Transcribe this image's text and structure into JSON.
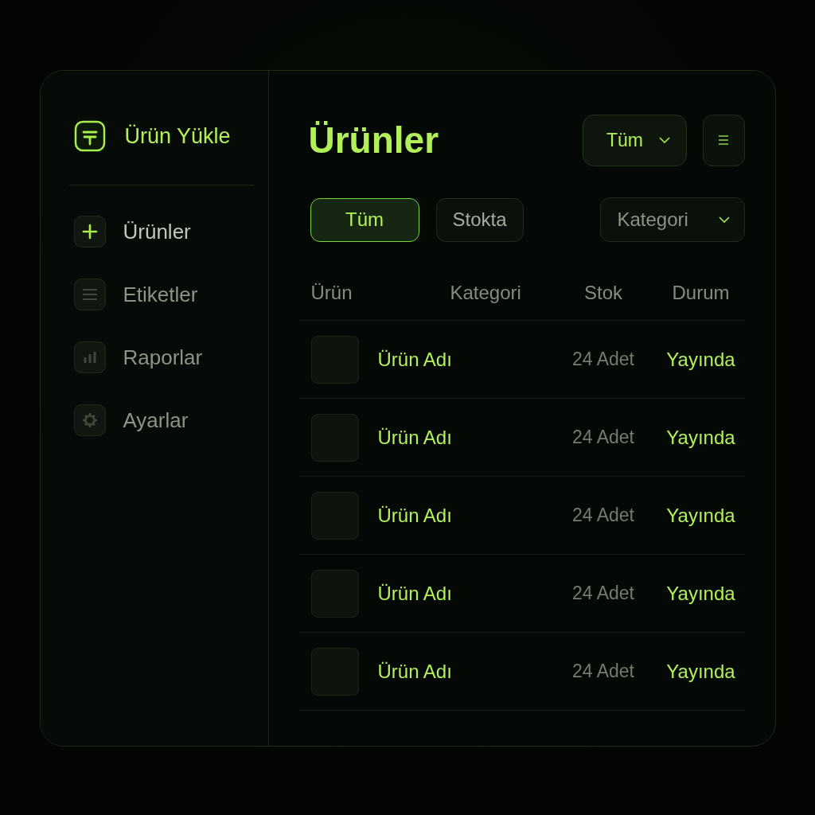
{
  "sidebar": {
    "brand": "Ürün Yükle",
    "items": [
      {
        "label": "Ürünler",
        "kind": "plus",
        "selected": true
      },
      {
        "label": "Etiketler",
        "kind": "lines",
        "selected": false
      },
      {
        "label": "Raporlar",
        "kind": "bars",
        "selected": false
      },
      {
        "label": "Ayarlar",
        "kind": "gear",
        "selected": false
      }
    ]
  },
  "header": {
    "title": "Ürünler",
    "dropdown": "Tüm"
  },
  "filters": [
    {
      "label": "Tüm",
      "selected": true
    },
    {
      "label": "Stokta",
      "selected": false
    }
  ],
  "category_dropdown": "Kategori",
  "table": {
    "columns": [
      "Ürün",
      "Kategori",
      "Stok",
      "Durum"
    ],
    "rows": [
      {
        "name": "Ürün Adı",
        "stock": "24 Adet",
        "status": "Yayında"
      },
      {
        "name": "Ürün Adı",
        "stock": "24 Adet",
        "status": "Yayında"
      },
      {
        "name": "Ürün Adı",
        "stock": "24 Adet",
        "status": "Yayında"
      },
      {
        "name": "Ürün Adı",
        "stock": "24 Adet",
        "status": "Yayında"
      },
      {
        "name": "Ürün Adı",
        "stock": "24 Adet",
        "status": "Yayında"
      }
    ]
  }
}
